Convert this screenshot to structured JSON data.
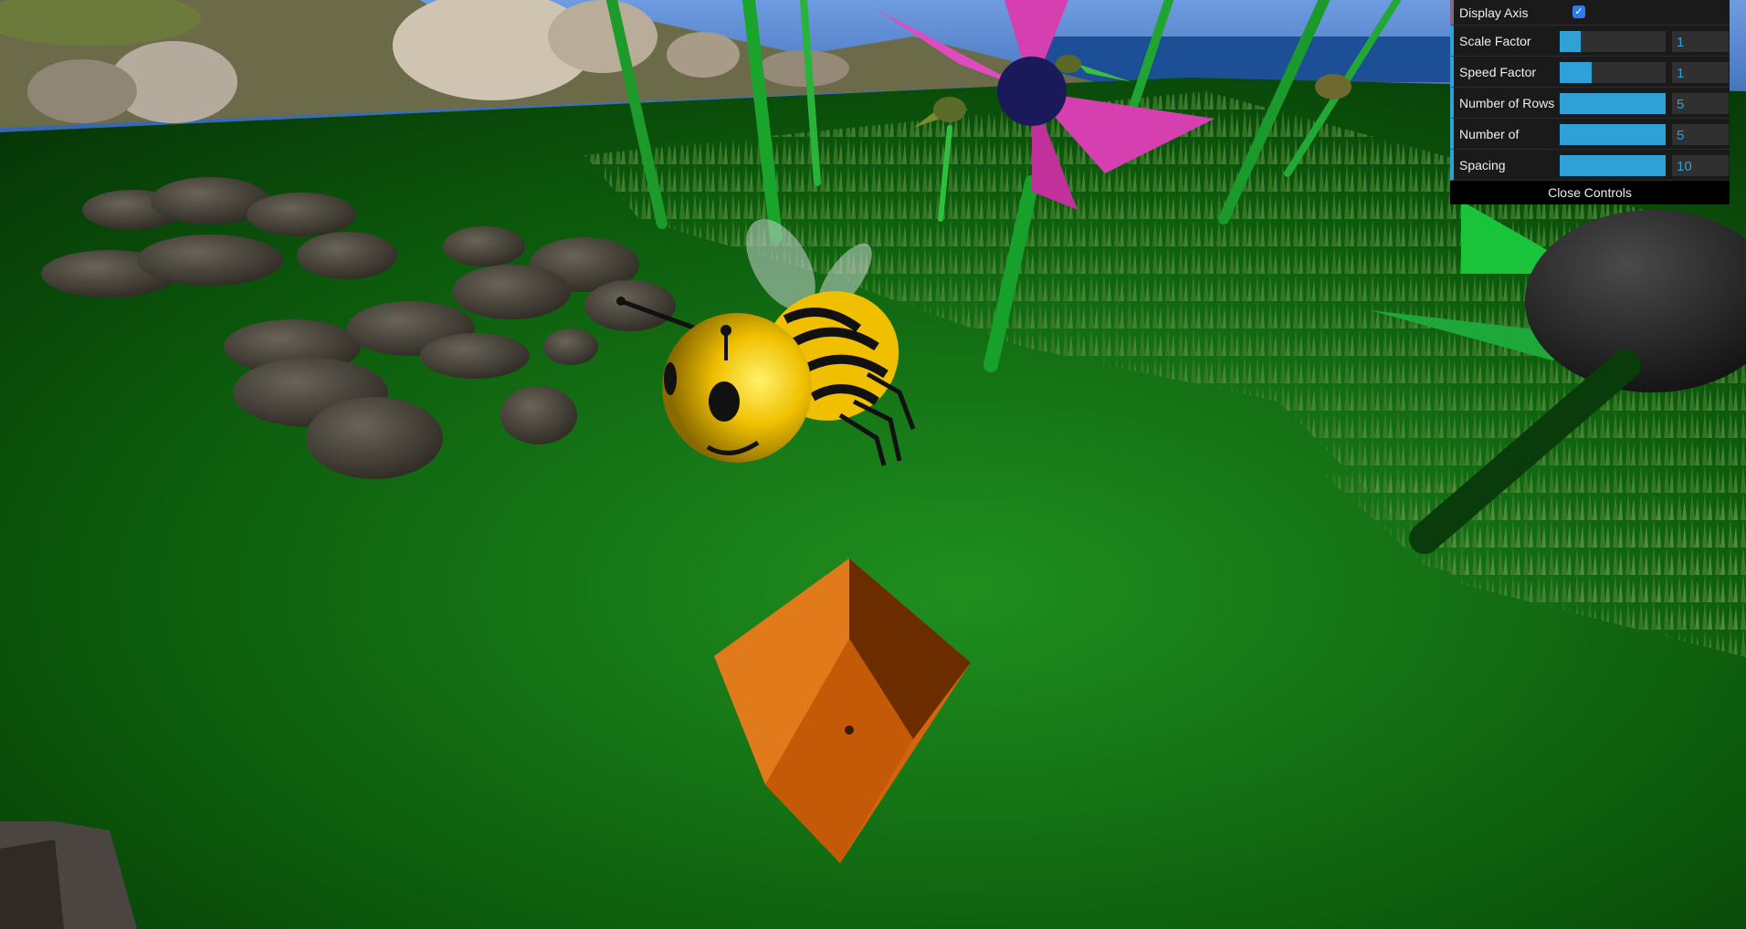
{
  "scene": {
    "sky_color": "#4a79b8",
    "ground_color": "#0f5c0f",
    "bee_body_color": "#f0c000",
    "flower_petal_color": "#d63fb0",
    "box_color": "#e06a10"
  },
  "controls": {
    "display_axis": {
      "label": "Display Axis",
      "checked": true
    },
    "scale_factor": {
      "label": "Scale Factor",
      "value": "1",
      "fill": 0.2
    },
    "speed_factor": {
      "label": "Speed Factor",
      "value": "1",
      "fill": 0.3
    },
    "num_rows": {
      "label": "Number of Rows",
      "value": "5",
      "fill": 1.0
    },
    "num_cols": {
      "label": "Number of",
      "value": "5",
      "fill": 1.0
    },
    "spacing": {
      "label": "Spacing",
      "value": "10",
      "fill": 1.0
    },
    "close_label": "Close Controls"
  }
}
